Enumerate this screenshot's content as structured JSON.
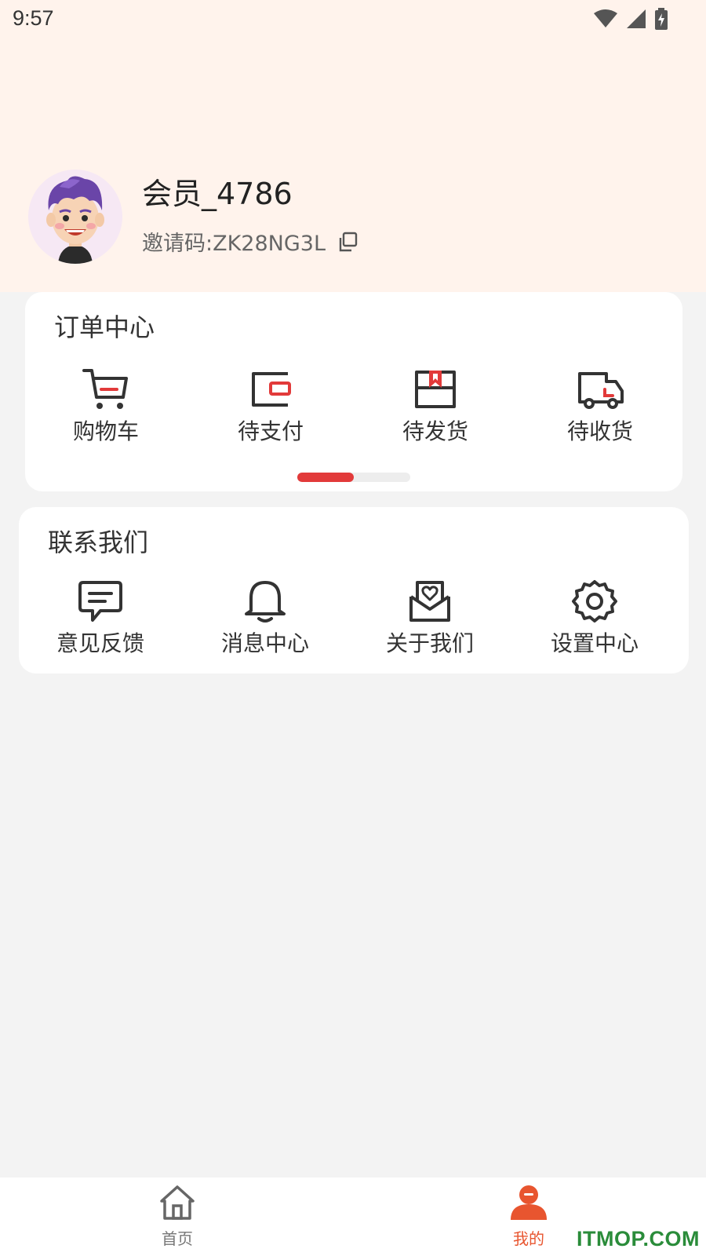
{
  "status_bar": {
    "time": "9:57",
    "icons": [
      "wifi-icon",
      "signal-icon",
      "battery-charging-icon"
    ]
  },
  "profile": {
    "avatar": "avatar-boy-purple-hair",
    "username": "会员_4786",
    "invite_code": "邀请码:ZK28NG3L",
    "copy_icon": "copy-icon"
  },
  "order_center": {
    "title": "订单中心",
    "items": [
      {
        "label": "购物车",
        "icon": "cart-icon"
      },
      {
        "label": "待支付",
        "icon": "wallet-icon"
      },
      {
        "label": "待发货",
        "icon": "box-icon"
      },
      {
        "label": "待收货",
        "icon": "truck-icon"
      }
    ],
    "page_indicator": {
      "page": 1,
      "pages": 2
    }
  },
  "contact_us": {
    "title": "联系我们",
    "items": [
      {
        "label": "意见反馈",
        "icon": "feedback-icon"
      },
      {
        "label": "消息中心",
        "icon": "bell-icon"
      },
      {
        "label": "关于我们",
        "icon": "heart-mail-icon"
      },
      {
        "label": "设置中心",
        "icon": "gear-icon"
      }
    ]
  },
  "tabbar": {
    "tabs": [
      {
        "label": "首页",
        "icon": "home-icon",
        "active": false
      },
      {
        "label": "我的",
        "icon": "user-icon",
        "active": true
      }
    ]
  },
  "colors": {
    "accent": "#e23a3a",
    "active_tab": "#e8552f",
    "header_bg": "#fff3ec",
    "page_bg": "#f3f3f3"
  },
  "watermark": "ITMOP.COM"
}
